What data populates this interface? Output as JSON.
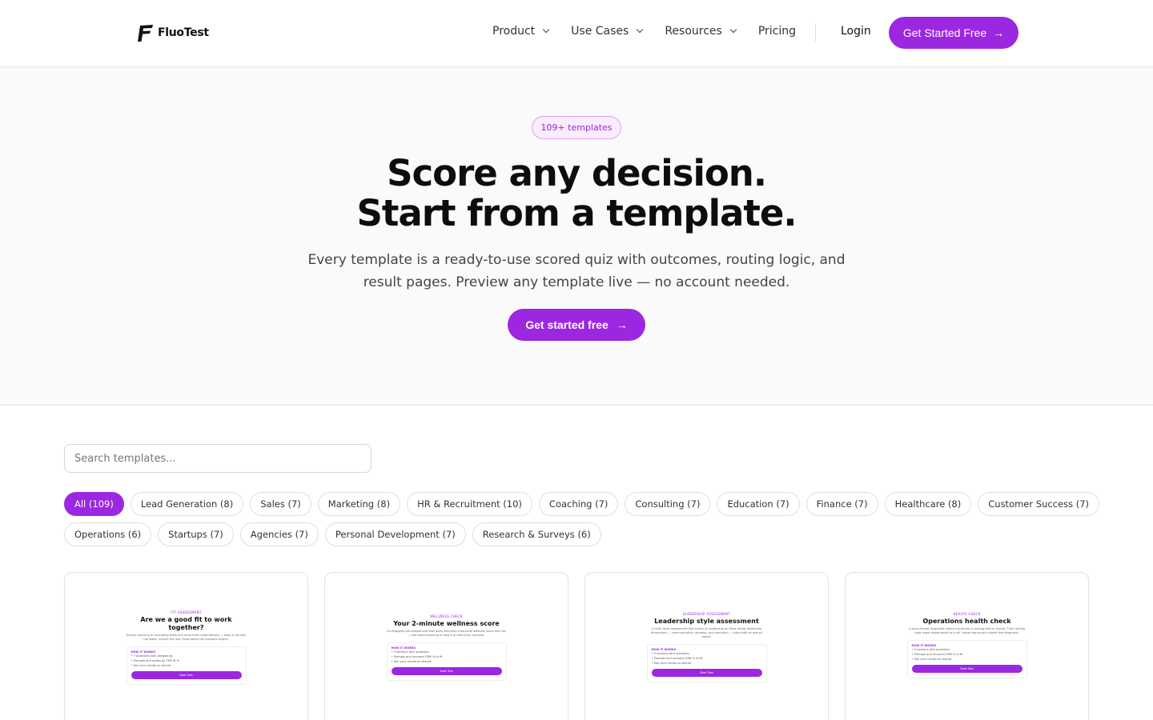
{
  "header": {
    "logo_text": "FluoTest",
    "nav": [
      {
        "label": "Product",
        "has_dropdown": true
      },
      {
        "label": "Use Cases",
        "has_dropdown": true
      },
      {
        "label": "Resources",
        "has_dropdown": true
      },
      {
        "label": "Pricing",
        "has_dropdown": false
      }
    ],
    "login_label": "Login",
    "cta_label": "Get Started Free",
    "cta_icon": "arrow-right-icon"
  },
  "hero": {
    "badge": "109+ templates",
    "title_line1": "Score any decision.",
    "title_line2": "Start from a template.",
    "subtitle_line1": "Every template is a ready-to-use scored quiz with outcomes, routing logic, and",
    "subtitle_line2": "result pages. Preview any template live — no account needed.",
    "cta_label": "Get started free"
  },
  "search": {
    "placeholder": "Search templates..."
  },
  "filters": [
    {
      "label": "All (109)",
      "active": true
    },
    {
      "label": "Lead Generation (8)"
    },
    {
      "label": "Sales (7)"
    },
    {
      "label": "Marketing (8)"
    },
    {
      "label": "HR & Recruitment (10)"
    },
    {
      "label": "Coaching (7)"
    },
    {
      "label": "Consulting (7)"
    },
    {
      "label": "Education (7)"
    },
    {
      "label": "Finance (7)"
    },
    {
      "label": "Healthcare (8)"
    },
    {
      "label": "Customer Success (7)"
    },
    {
      "label": "Operations (6)"
    },
    {
      "label": "Startups (7)"
    },
    {
      "label": "Agencies (7)"
    },
    {
      "label": "Personal Development (7)"
    },
    {
      "label": "Research & Surveys (6)"
    }
  ],
  "cards": [
    {
      "tag": "FIT ASSESSMENT",
      "title": "Are we a good fit to work together?",
      "desc": "Qualify coaching or consulting leads and route them automatically — book a call with hot leads, nurture the rest. Know about the outcome engine.",
      "how": "HOW IT WORKS",
      "items": [
        "7 questions with weightings",
        "Prompts and routes by TMS fit %",
        "See your results as shared"
      ],
      "button": "Start Test"
    },
    {
      "tag": "WELLNESS CHECK",
      "title": "Your 2-minute wellness score",
      "desc": "An engaging self-assessment that gives everyone a personal wellness score and tips — with benchmarking to help it to have they compare.",
      "how": "HOW IT WORKS",
      "items": [
        "3 sections with questions",
        "Prompts and recovery FMB % to fit",
        "See your results as shared"
      ],
      "button": "Start Test"
    },
    {
      "tag": "LEADERSHIP ASSESSMENT",
      "title": "Leadership style assessment",
      "desc": "A multi-facet assessment that scores on leadership on three rocket leadership dimensions — communication, strategy, and execution — score with an overall report.",
      "how": "HOW IT WORKS",
      "items": [
        "3 sections with questions",
        "Prompts and recovery FMB % to fit",
        "See your results as shared"
      ],
      "button": "Start Test"
    },
    {
      "tag": "HEALTH CHECK",
      "title": "Operations health check",
      "desc": "A score-format diagnostic where a business is looking time or money. Then routing logic maps respondents to a call, target signup and submit free diagnosis.",
      "how": "HOW IT WORKS",
      "items": [
        "3 sections with questions",
        "Prompts and recovery FMB % to fit",
        "See your results as shared"
      ],
      "button": "Start Test"
    }
  ]
}
